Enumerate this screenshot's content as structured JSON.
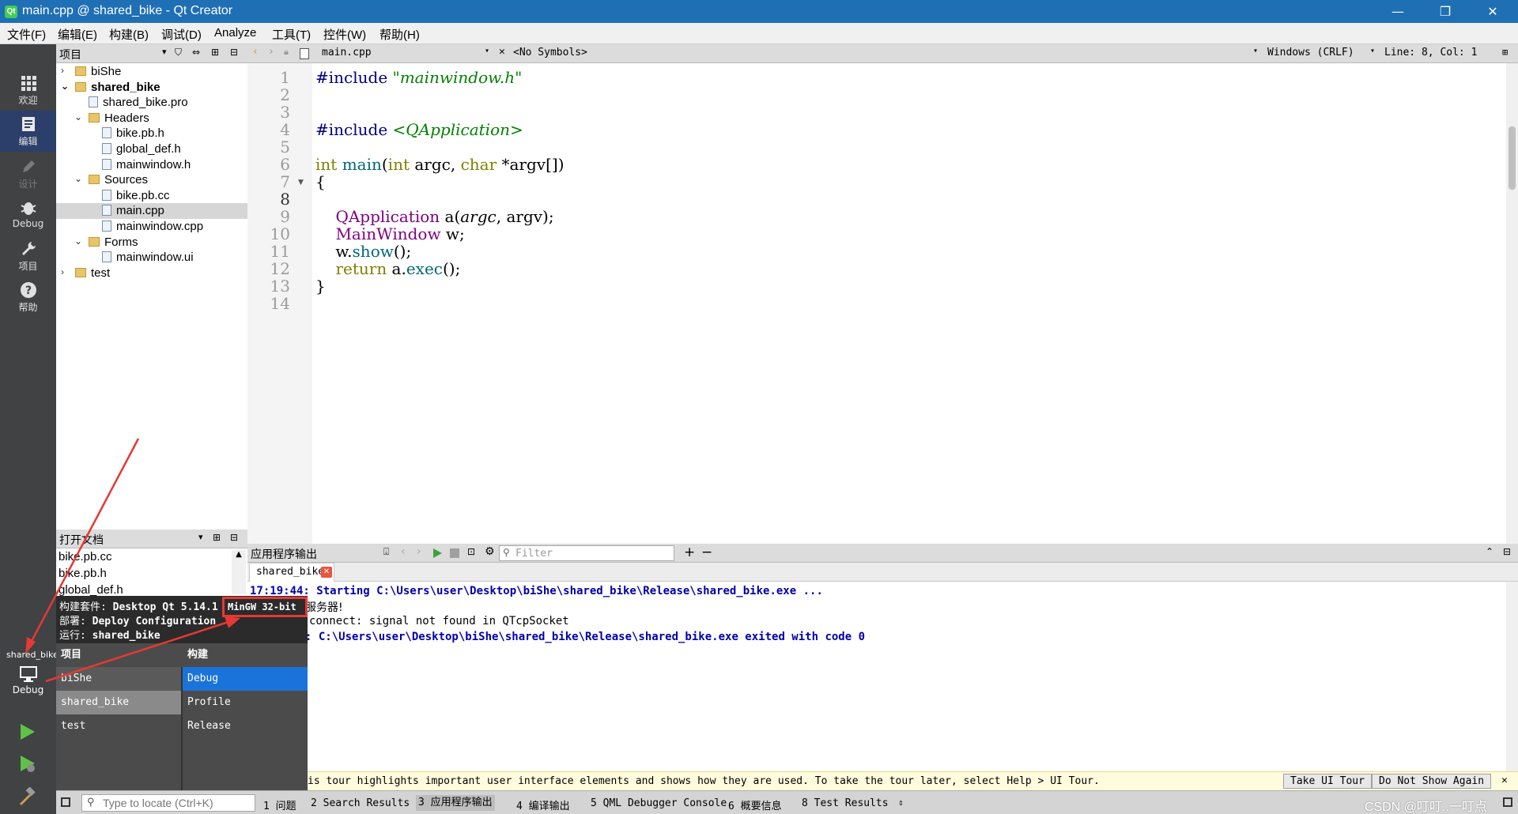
{
  "window": {
    "title": "main.cpp @ shared_bike - Qt Creator",
    "logo": "Qt"
  },
  "menubar": [
    "文件(F)",
    "编辑(E)",
    "构建(B)",
    "调试(D)",
    "Analyze",
    "工具(T)",
    "控件(W)",
    "帮助(H)"
  ],
  "modes": [
    {
      "label": "欢迎",
      "icon": "grid-icon"
    },
    {
      "label": "编辑",
      "icon": "document-icon"
    },
    {
      "label": "设计",
      "icon": "pencil-icon"
    },
    {
      "label": "Debug",
      "icon": "bug-icon"
    },
    {
      "label": "项目",
      "icon": "wrench-icon"
    },
    {
      "label": "帮助",
      "icon": "help-icon"
    }
  ],
  "target": {
    "project": "shared_bike",
    "mode": "Debug"
  },
  "project_panel": {
    "title": "项目",
    "tree": [
      {
        "label": "biShe",
        "kind": "folder",
        "depth": 0,
        "expanded": false
      },
      {
        "label": "shared_bike",
        "kind": "folder",
        "depth": 0,
        "expanded": true,
        "bold": true
      },
      {
        "label": "shared_bike.pro",
        "kind": "file",
        "depth": 1
      },
      {
        "label": "Headers",
        "kind": "folder",
        "depth": 1,
        "expanded": true
      },
      {
        "label": "bike.pb.h",
        "kind": "file",
        "depth": 2
      },
      {
        "label": "global_def.h",
        "kind": "file",
        "depth": 2
      },
      {
        "label": "mainwindow.h",
        "kind": "file",
        "depth": 2
      },
      {
        "label": "Sources",
        "kind": "folder",
        "depth": 1,
        "expanded": true
      },
      {
        "label": "bike.pb.cc",
        "kind": "file",
        "depth": 2
      },
      {
        "label": "main.cpp",
        "kind": "file",
        "depth": 2,
        "selected": true
      },
      {
        "label": "mainwindow.cpp",
        "kind": "file",
        "depth": 2
      },
      {
        "label": "Forms",
        "kind": "folder",
        "depth": 1,
        "expanded": true
      },
      {
        "label": "mainwindow.ui",
        "kind": "file",
        "depth": 2
      },
      {
        "label": "test",
        "kind": "folder",
        "depth": 0,
        "expanded": false
      }
    ]
  },
  "open_docs": {
    "title": "打开文档",
    "items": [
      "bike.pb.cc",
      "bike.pb.h",
      "global_def.h"
    ]
  },
  "editor": {
    "file": "main.cpp",
    "symbols": "<No Symbols>",
    "line_ending": "Windows (CRLF)",
    "position": "Line: 8, Col: 1",
    "lines": [
      "#include \"mainwindow.h\"",
      "",
      "",
      "#include <QApplication>",
      "",
      "int main(int argc, char *argv[])",
      "{",
      "",
      "    QApplication a(argc, argv);",
      "    MainWindow w;",
      "    w.show();",
      "    return a.exec();",
      "}",
      ""
    ]
  },
  "output": {
    "title": "应用程序输出",
    "filter_placeholder": "Filter",
    "tab": "shared_bike",
    "lines": [
      "17:19:44: Starting C:\\Users\\user\\Desktop\\biShe\\shared_bike\\Release\\shared_bike.exe ...",
      "服务器!",
      "connect: signal not found in QTcpSocket",
      ": C:\\Users\\user\\Desktop\\biShe\\shared_bike\\Release\\shared_bike.exe exited with code 0"
    ]
  },
  "tour": {
    "text": "is tour highlights important user interface elements and shows how they are used. To take the tour later, select Help > UI Tour.",
    "take_label": "Take UI Tour",
    "dismiss_label": "Do Not Show Again"
  },
  "kit_popup": {
    "kit_label": "构建套件:",
    "kit_value": "Desktop Qt 5.14.1",
    "kit_highlight": "MinGW 32-bit",
    "deploy_label": "部署:",
    "deploy_value": "Deploy Configuration",
    "run_label": "运行:",
    "run_value": "shared_bike",
    "col_project": "项目",
    "col_build": "构建",
    "projects": [
      "biShe",
      "shared_bike",
      "test"
    ],
    "builds": [
      "Debug",
      "Profile",
      "Release"
    ],
    "selected_project": "shared_bike",
    "selected_build": "Debug"
  },
  "statusbar": {
    "locate_placeholder": "Type to locate (Ctrl+K)",
    "tabs": [
      "1 问题",
      "2 Search Results",
      "3 应用程序输出",
      "4 编译输出",
      "5 QML Debugger Console",
      "6 概要信息",
      "8 Test Results"
    ]
  },
  "watermark": "CSDN @叮叮..一叮点",
  "colors": {
    "titlebar": "#1f6fb5",
    "annotation": "#e53935",
    "selected_build": "#1a73d9"
  }
}
